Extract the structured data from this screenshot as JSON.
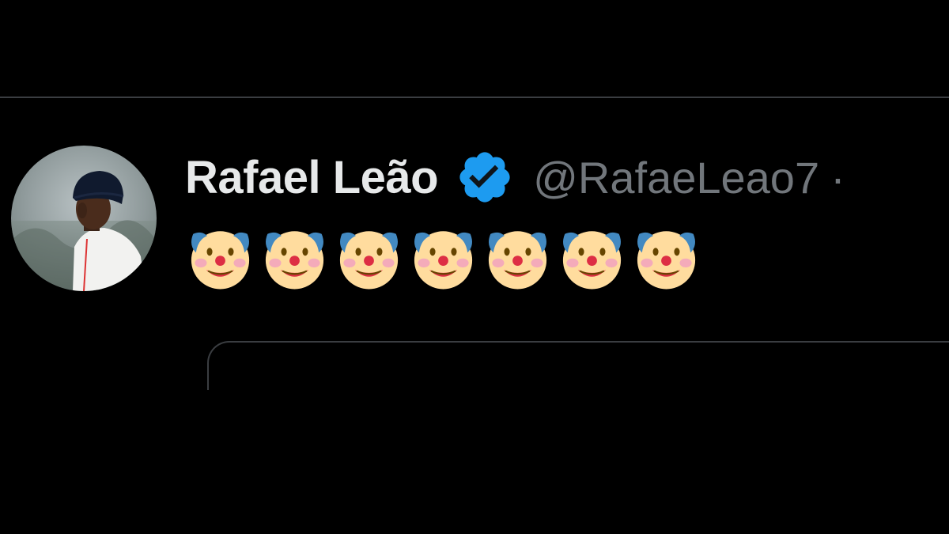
{
  "tweet": {
    "author": {
      "display_name": "Rafael Leão",
      "handle": "@RafaeLeao7",
      "separator": "·",
      "verified": true,
      "verified_icon": "verified-badge-icon",
      "avatar_icon": "profile-photo"
    },
    "body": {
      "emoji": [
        "🤡",
        "🤡",
        "🤡",
        "🤡",
        "🤡",
        "🤡",
        "🤡"
      ],
      "emoji_count": 7,
      "emoji_icon": "clown-face-icon"
    }
  },
  "colors": {
    "background": "#000000",
    "name": "#e7e9ea",
    "handle": "#71767b",
    "verified": "#1d9bf0",
    "divider": "#3a3d41"
  }
}
